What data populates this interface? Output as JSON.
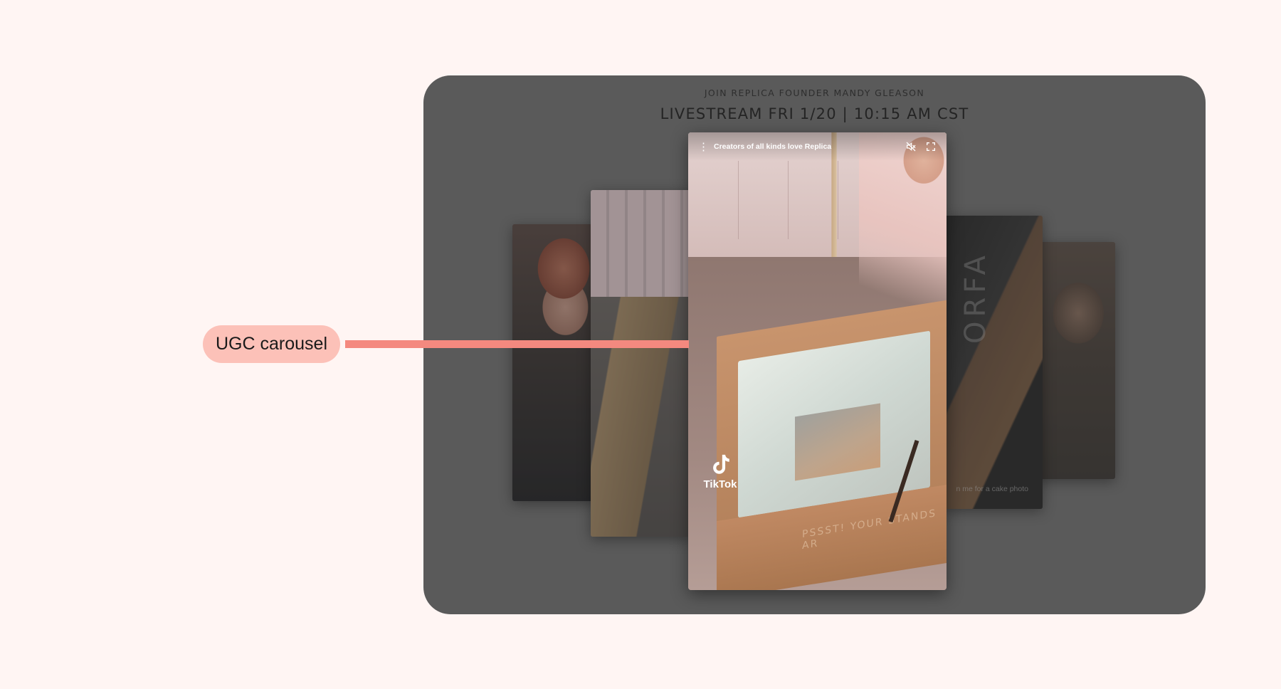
{
  "annotation": {
    "label": "UGC carousel"
  },
  "panel": {
    "eyebrow": "JOIN REPLICA FOUNDER MANDY GLEASON",
    "headline": "LIVESTREAM FRI 1/20 | 10:15 AM CST"
  },
  "video": {
    "title": "Creators of all kinds love Replica",
    "brand": "TikTok",
    "box_text": "PSSST! YOUR STANDS AR"
  },
  "side_cards": {
    "right_brand": "ORFA",
    "right_caption": "n me for a cake photo"
  },
  "icons": {
    "menu": "more-vertical-icon",
    "mute": "volume-muted-icon",
    "fullscreen": "fullscreen-icon",
    "logo": "tiktok-logo-icon"
  },
  "colors": {
    "page_bg": "#fff5f3",
    "panel_bg": "#5a5a5a",
    "callout_bg": "#fcc1b8",
    "callout_line": "#f4897f"
  }
}
